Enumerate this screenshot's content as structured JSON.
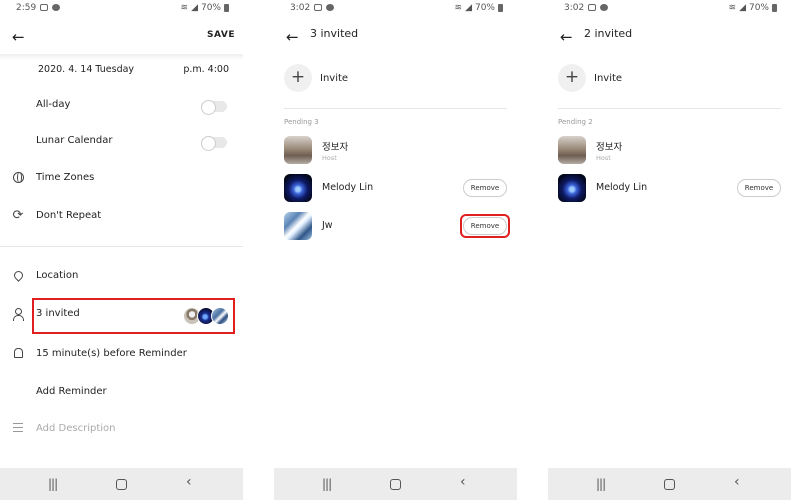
{
  "screens": [
    {
      "status": {
        "time": "2:59",
        "battery": "70%"
      },
      "header": {
        "save": "SAVE"
      },
      "date": {
        "date": "2020. 4. 14 Tuesday",
        "time": "p.m. 4:00"
      },
      "rows": {
        "all_day": "All-day",
        "lunar": "Lunar Calendar",
        "time_zones": "Time Zones",
        "repeat": "Don't Repeat",
        "location": "Location",
        "invited": "3 invited",
        "reminder": "15 minute(s) before Reminder",
        "add_reminder": "Add Reminder",
        "add_description": "Add Description"
      },
      "toggles": {
        "all_day": false,
        "lunar": false
      }
    },
    {
      "status": {
        "time": "3:02",
        "battery": "70%"
      },
      "title": "3 invited",
      "invite": "Invite",
      "pending": "Pending 3",
      "members": [
        {
          "name": "정보자",
          "sub": "Host"
        },
        {
          "name": "Melody Lin",
          "action": "Remove"
        },
        {
          "name": "Jw",
          "action": "Remove"
        }
      ]
    },
    {
      "status": {
        "time": "3:02",
        "battery": "70%"
      },
      "title": "2 invited",
      "invite": "Invite",
      "pending": "Pending 2",
      "members": [
        {
          "name": "정보자",
          "sub": "Host"
        },
        {
          "name": "Melody Lin",
          "action": "Remove"
        }
      ]
    }
  ],
  "icons": {
    "back": "back-arrow-icon",
    "recent": "recent-apps-icon",
    "home": "home-icon",
    "nav_back": "nav-back-icon"
  },
  "colors": {
    "highlight": "#e0201f",
    "navbar": "#ececec"
  }
}
